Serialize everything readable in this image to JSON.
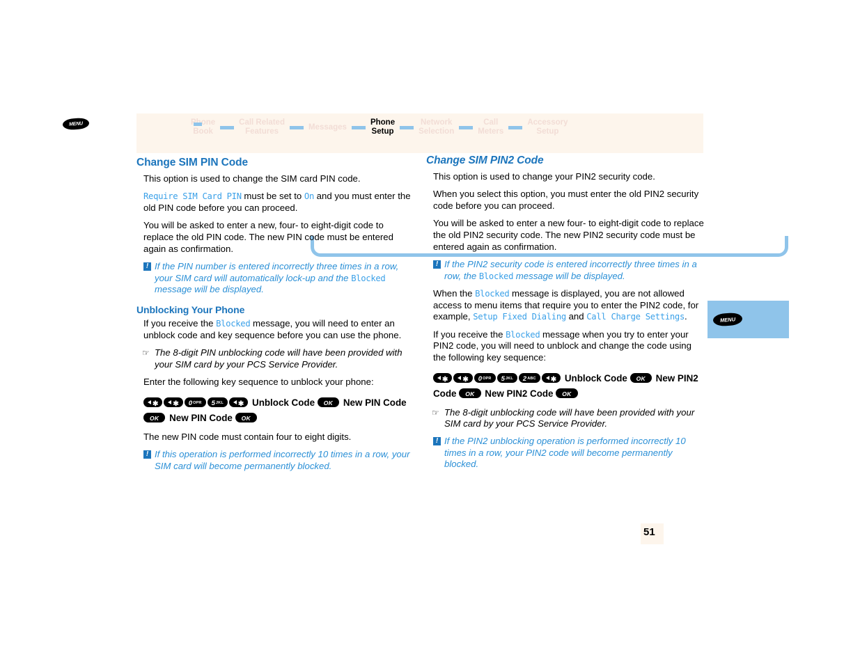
{
  "page": {
    "number": "51",
    "accent_blue": "#1c75bc",
    "light_blue": "#8fc4ea",
    "cream": "#fdf5ec"
  },
  "breadcrumb": {
    "menu_label": "MENU",
    "items": [
      {
        "label": "Phone\nBook",
        "active": false
      },
      {
        "label": "Call Related\nFeatures",
        "active": false
      },
      {
        "label": "Messages",
        "active": false
      },
      {
        "label": "Phone\nSetup",
        "active": true
      },
      {
        "label": "Network\nSelection",
        "active": false
      },
      {
        "label": "Call\nMeters",
        "active": false
      },
      {
        "label": "Accessory\nSetup",
        "active": false
      }
    ]
  },
  "side_tab": {
    "menu_label": "MENU"
  },
  "left_column": {
    "heading": "Change SIM PIN Code",
    "p1": "This option is used to change the SIM card PIN code.",
    "p2_code1": "Require SIM Card PIN",
    "p2_mid": " must be set to ",
    "p2_code2": "On",
    "p2_end": " and you must enter the old PIN code before you can proceed.",
    "p3": "You will be asked to enter a new, four- to eight-digit code to replace the old PIN code. The new PIN code must be entered again as confirmation.",
    "note1_a": "If the PIN number is entered incorrectly three times in a row, your SIM card will automatically lock-up and the ",
    "note1_code": "Blocked",
    "note1_b": " message will be displayed.",
    "subheading": "Unblocking Your Phone",
    "p4_a": "If you receive the ",
    "p4_code": "Blocked",
    "p4_b": " message, you will need to enter an unblock code and key sequence before you can use the phone.",
    "tip1": "The 8-digit PIN unblocking code will have been provided with your SIM card by your PCS Service Provider.",
    "p5": "Enter the following key sequence to unblock your phone:",
    "keyseq": [
      {
        "type": "key",
        "glyph": "back-star",
        "num": "",
        "sup": ""
      },
      {
        "type": "key",
        "glyph": "back-star",
        "num": "",
        "sup": ""
      },
      {
        "type": "key",
        "glyph": "num",
        "num": "0",
        "sup": "OPR"
      },
      {
        "type": "key",
        "glyph": "num",
        "num": "5",
        "sup": "JKL"
      },
      {
        "type": "key",
        "glyph": "back-star",
        "num": "",
        "sup": ""
      },
      {
        "type": "word",
        "text": "Unblock Code"
      },
      {
        "type": "ok",
        "text": "OK"
      },
      {
        "type": "word",
        "text": "New PIN Code"
      },
      {
        "type": "ok",
        "text": "OK"
      },
      {
        "type": "word",
        "text": "New PIN Code"
      },
      {
        "type": "ok",
        "text": "OK"
      }
    ],
    "p6": "The new PIN code must contain four to eight digits.",
    "note2": "If this operation is performed incorrectly 10 times in a row, your SIM card will become permanently blocked."
  },
  "right_column": {
    "heading": "Change SIM PIN2 Code",
    "p1": "This option is used to change your PIN2 security code.",
    "p2": "When you select this option, you must enter the old PIN2 security code before you can proceed.",
    "p3": "You will be asked to enter a new four- to eight-digit code to replace the old PIN2 security code. The new PIN2 security code must be entered again as confirmation.",
    "note1_a": "If the PIN2 security code is entered incorrectly three times in a row, the ",
    "note1_code": "Blocked",
    "note1_b": " message will be displayed.",
    "p4_a": "When the ",
    "p4_code1": "Blocked",
    "p4_b": " message is displayed, you are not allowed access to menu items that require you to enter the PIN2 code, for example, ",
    "p4_code2": "Setup Fixed Dialing",
    "p4_c": " and ",
    "p4_code3": "Call Charge Settings",
    "p4_d": ".",
    "p5_a": "If you receive the ",
    "p5_code": "Blocked",
    "p5_b": " message when you try to enter your PIN2 code, you will need to unblock and change the code using the following key sequence:",
    "keyseq": [
      {
        "type": "key",
        "glyph": "back-star",
        "num": "",
        "sup": ""
      },
      {
        "type": "key",
        "glyph": "back-star",
        "num": "",
        "sup": ""
      },
      {
        "type": "key",
        "glyph": "num",
        "num": "0",
        "sup": "OPR"
      },
      {
        "type": "key",
        "glyph": "num",
        "num": "5",
        "sup": "JKL"
      },
      {
        "type": "key",
        "glyph": "num",
        "num": "2",
        "sup": "ABC"
      },
      {
        "type": "key",
        "glyph": "back-star",
        "num": "",
        "sup": ""
      },
      {
        "type": "word",
        "text": "Unblock Code"
      },
      {
        "type": "ok",
        "text": "OK"
      },
      {
        "type": "word",
        "text": "New PIN2 Code"
      },
      {
        "type": "ok",
        "text": "OK"
      },
      {
        "type": "word",
        "text": "New PIN2 Code"
      },
      {
        "type": "ok",
        "text": "OK"
      }
    ],
    "tip1": "The 8-digit unblocking code will have been provided with your SIM card by your PCS Service Provider.",
    "note2": "If the PIN2 unblocking operation is performed incorrectly 10 times in a row, your PIN2 code will become permanently blocked."
  }
}
